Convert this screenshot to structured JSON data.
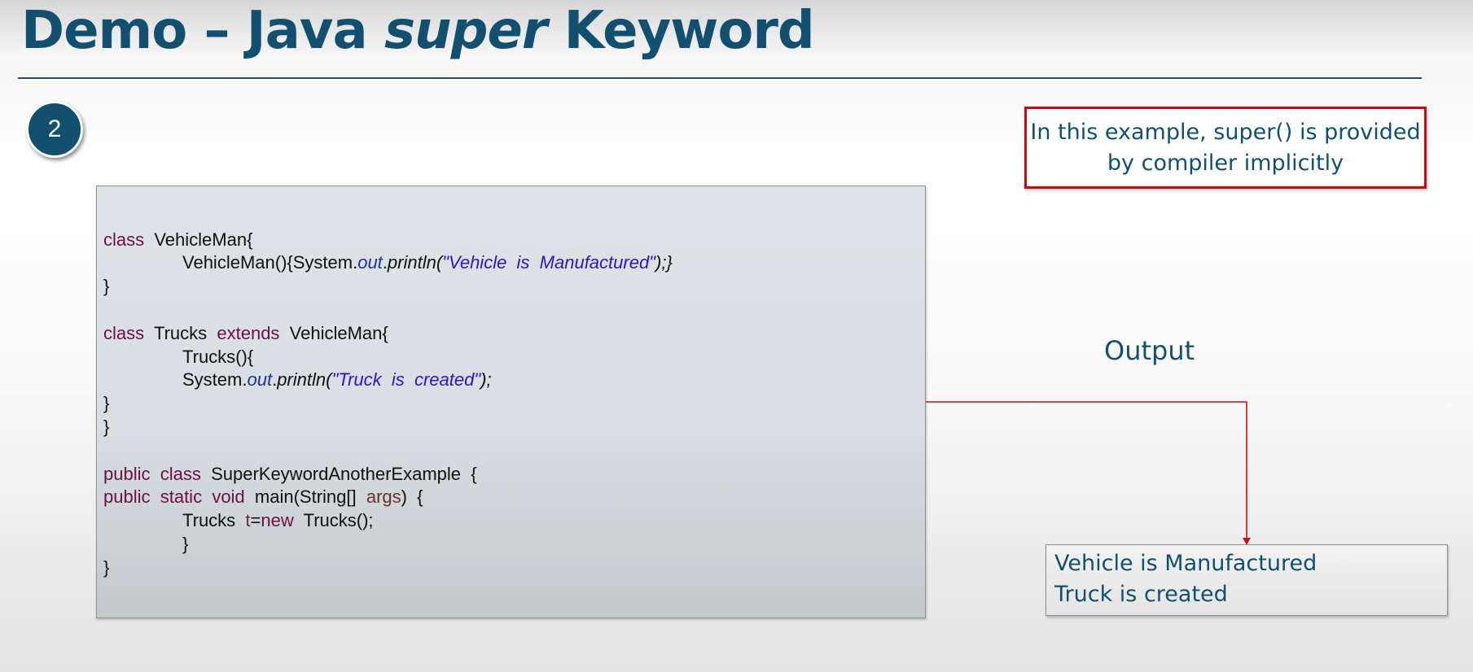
{
  "slide": {
    "title_prefix": "Demo – Java ",
    "title_italic": "super",
    "title_suffix": " Keyword",
    "number": "2"
  },
  "note": {
    "line1": "In this example, super() is provided",
    "line2": "by compiler implicitly"
  },
  "code": {
    "l1_kw": "class",
    "l1_rest": "  VehicleMan{",
    "l2_a": "VehicleMan(){System.",
    "l2_out": "out",
    "l2_dot": ".",
    "l2_println": "println(",
    "l2_str": "\"Vehicle  is  Manufactured\"",
    "l2_end": ");}",
    "l3": "}",
    "l5_kw1": "class",
    "l5_name": "  Trucks  ",
    "l5_kw2": "extends",
    "l5_rest": "  VehicleMan{",
    "l6": "Trucks(){",
    "l7_a": "System.",
    "l7_out": "out",
    "l7_dot": ".",
    "l7_println": "println(",
    "l7_str": "\"Truck  is  created\"",
    "l7_end": ");",
    "l8": "}",
    "l9": "}",
    "l11_kw1": "public",
    "l11_kw2": "class",
    "l11_rest": "  SuperKeywordAnotherExample  {",
    "l12_kw1": "public",
    "l12_kw2": "static",
    "l12_kw3": "void",
    "l12_a": "  main(String[]  ",
    "l12_var": "args",
    "l12_end": ")  {",
    "l13_a": "Trucks  ",
    "l13_var": "t",
    "l13_eq": "=",
    "l13_kw": "new",
    "l13_rest": "  Trucks();",
    "l14": "}",
    "l15": "}"
  },
  "output": {
    "label": "Output",
    "line1": "Vehicle is Manufactured",
    "line2": "Truck is created"
  },
  "colors": {
    "title": "#13506f",
    "accent_red": "#c00d14",
    "keyword": "#6b1048",
    "string": "#2a17c0"
  }
}
